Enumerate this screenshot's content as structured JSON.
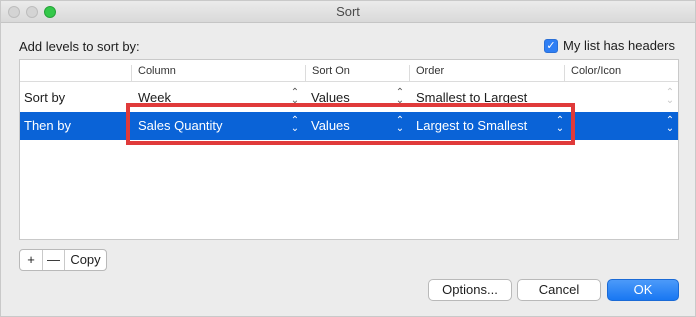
{
  "window": {
    "title": "Sort"
  },
  "dialog": {
    "add_levels_label": "Add levels to sort by:",
    "headers_checkbox_label": "My list has headers",
    "headers_checked": true
  },
  "table": {
    "columns": [
      "Column",
      "Sort On",
      "Order",
      "Color/Icon"
    ],
    "rows": [
      {
        "label": "Sort by",
        "column": "Week",
        "sort_on": "Values",
        "order": "Smallest to Largest",
        "color_icon": ""
      },
      {
        "label": "Then by",
        "column": "Sales Quantity",
        "sort_on": "Values",
        "order": "Largest to Smallest",
        "color_icon": ""
      }
    ],
    "selected_row": 1
  },
  "level_controls": {
    "add": "+",
    "remove": "—",
    "copy": "Copy"
  },
  "buttons": {
    "options": "Options...",
    "cancel": "Cancel",
    "ok": "OK"
  },
  "icons": {
    "popup": "up-down-chevron-icon",
    "check": "checkmark-icon"
  },
  "colors": {
    "selection": "#0a63d7",
    "highlight_border": "#e03a3a",
    "ok_button": "#1877f2"
  }
}
